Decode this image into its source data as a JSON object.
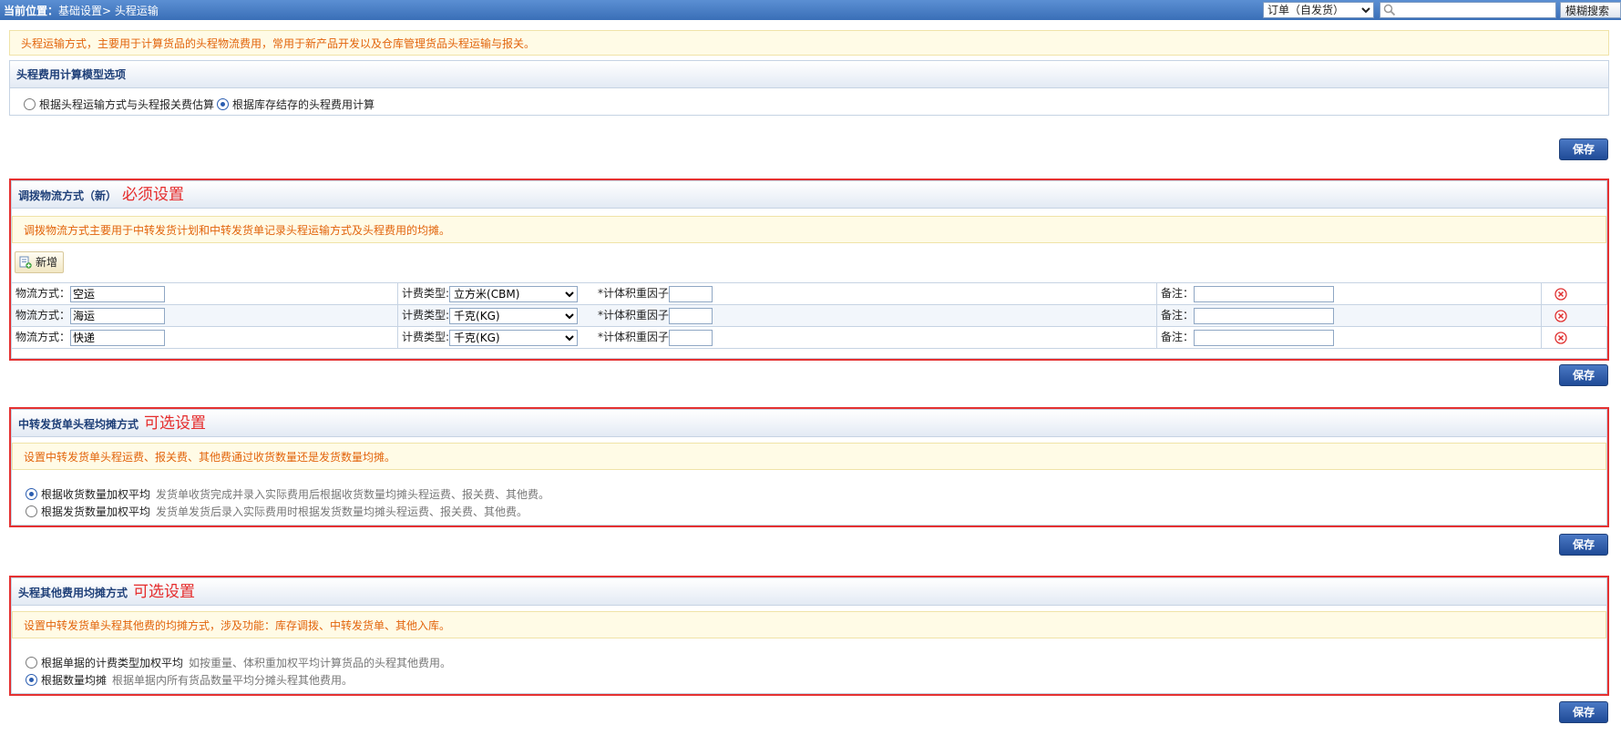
{
  "topbar": {
    "location_label": "当前位置：",
    "crumb": "基础设置> 头程运输",
    "scope_select": "订单（自发货）",
    "search_value": "",
    "fuzzy_search_label": "模糊搜索"
  },
  "intro_tip": "头程运输方式，主要用于计算货品的头程物流费用，常用于新产品开发以及仓库管理货品头程运输与报关。",
  "cost_model": {
    "title": "头程费用计算模型选项",
    "options": [
      {
        "label": "根据头程运输方式与头程报关费估算",
        "checked": false
      },
      {
        "label": "根据库存结存的头程费用计算",
        "checked": true
      }
    ]
  },
  "save_label": "保存",
  "transfer_logistics": {
    "title": "调拨物流方式（新）",
    "annotation": "必须设置",
    "tip": "调拨物流方式主要用于中转发货计划和中转发货单记录头程运输方式及头程费用的均摊。",
    "add_label": "新增",
    "method_label": "物流方式：",
    "billing_label": "计费类型:",
    "factor_label": "*计体积重因子",
    "remark_label": "备注：",
    "rows": [
      {
        "method": "空运",
        "billing": "立方米(CBM)",
        "factor": "",
        "remark": ""
      },
      {
        "method": "海运",
        "billing": "千克(KG)",
        "factor": "",
        "remark": ""
      },
      {
        "method": "快递",
        "billing": "千克(KG)",
        "factor": "",
        "remark": ""
      }
    ]
  },
  "allocation": {
    "title": "中转发货单头程均摊方式",
    "annotation": "可选设置",
    "tip": "设置中转发货单头程运费、报关费、其他费通过收货数量还是发货数量均摊。",
    "options": [
      {
        "label": "根据收货数量加权平均",
        "desc": "发货单收货完成并录入实际费用后根据收货数量均摊头程运费、报关费、其他费。",
        "checked": true
      },
      {
        "label": "根据发货数量加权平均",
        "desc": "发货单发货后录入实际费用时根据发货数量均摊头程运费、报关费、其他费。",
        "checked": false
      }
    ]
  },
  "other_fee": {
    "title": "头程其他费用均摊方式",
    "annotation": "可选设置",
    "tip": "设置中转发货单头程其他费的均摊方式，涉及功能：库存调拨、中转发货单、其他入库。",
    "options": [
      {
        "label": "根据单据的计费类型加权平均",
        "desc": "如按重量、体积重加权平均计算货品的头程其他费用。",
        "checked": false
      },
      {
        "label": "根据数量均摊",
        "desc": "根据单据内所有货品数量平均分摊头程其他费用。",
        "checked": true
      }
    ]
  },
  "colors": {
    "accent": "#1f4b97",
    "annotation_red": "#e53131",
    "tip_orange": "#e2640c"
  }
}
